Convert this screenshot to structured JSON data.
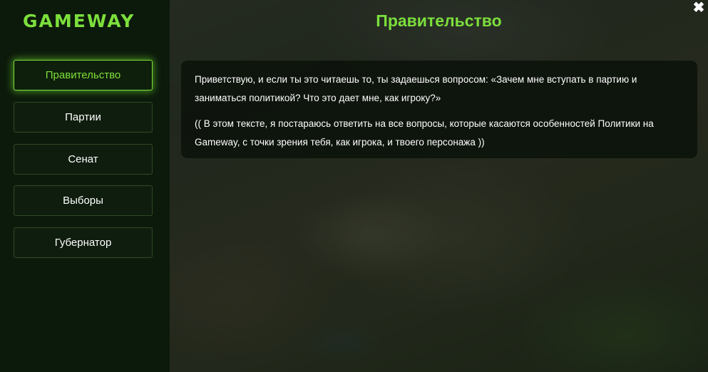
{
  "brand": {
    "logo_text": "GAMEWAY"
  },
  "sidebar": {
    "items": [
      {
        "label": "Правительство",
        "active": true
      },
      {
        "label": "Партии",
        "active": false
      },
      {
        "label": "Сенат",
        "active": false
      },
      {
        "label": "Выборы",
        "active": false
      },
      {
        "label": "Губернатор",
        "active": false
      }
    ]
  },
  "main": {
    "title": "Правительство",
    "paragraphs": [
      "Приветствую, и если ты это читаешь то, ты задаешься вопросом: «Зачем мне вступать в партию и заниматься политикой? Что это дает мне, как игроку?»",
      "(( В этом тексте, я постараюсь ответить на все вопросы, которые касаются особенностей Политики на Gameway, с точки зрения тебя, как игрока, и твоего персонажа ))"
    ]
  },
  "window": {
    "close_symbol": "✖"
  },
  "colors": {
    "accent": "#7cdf3c",
    "sidebar_bg": "#0c1a0b",
    "card_bg": "#0a120a"
  }
}
